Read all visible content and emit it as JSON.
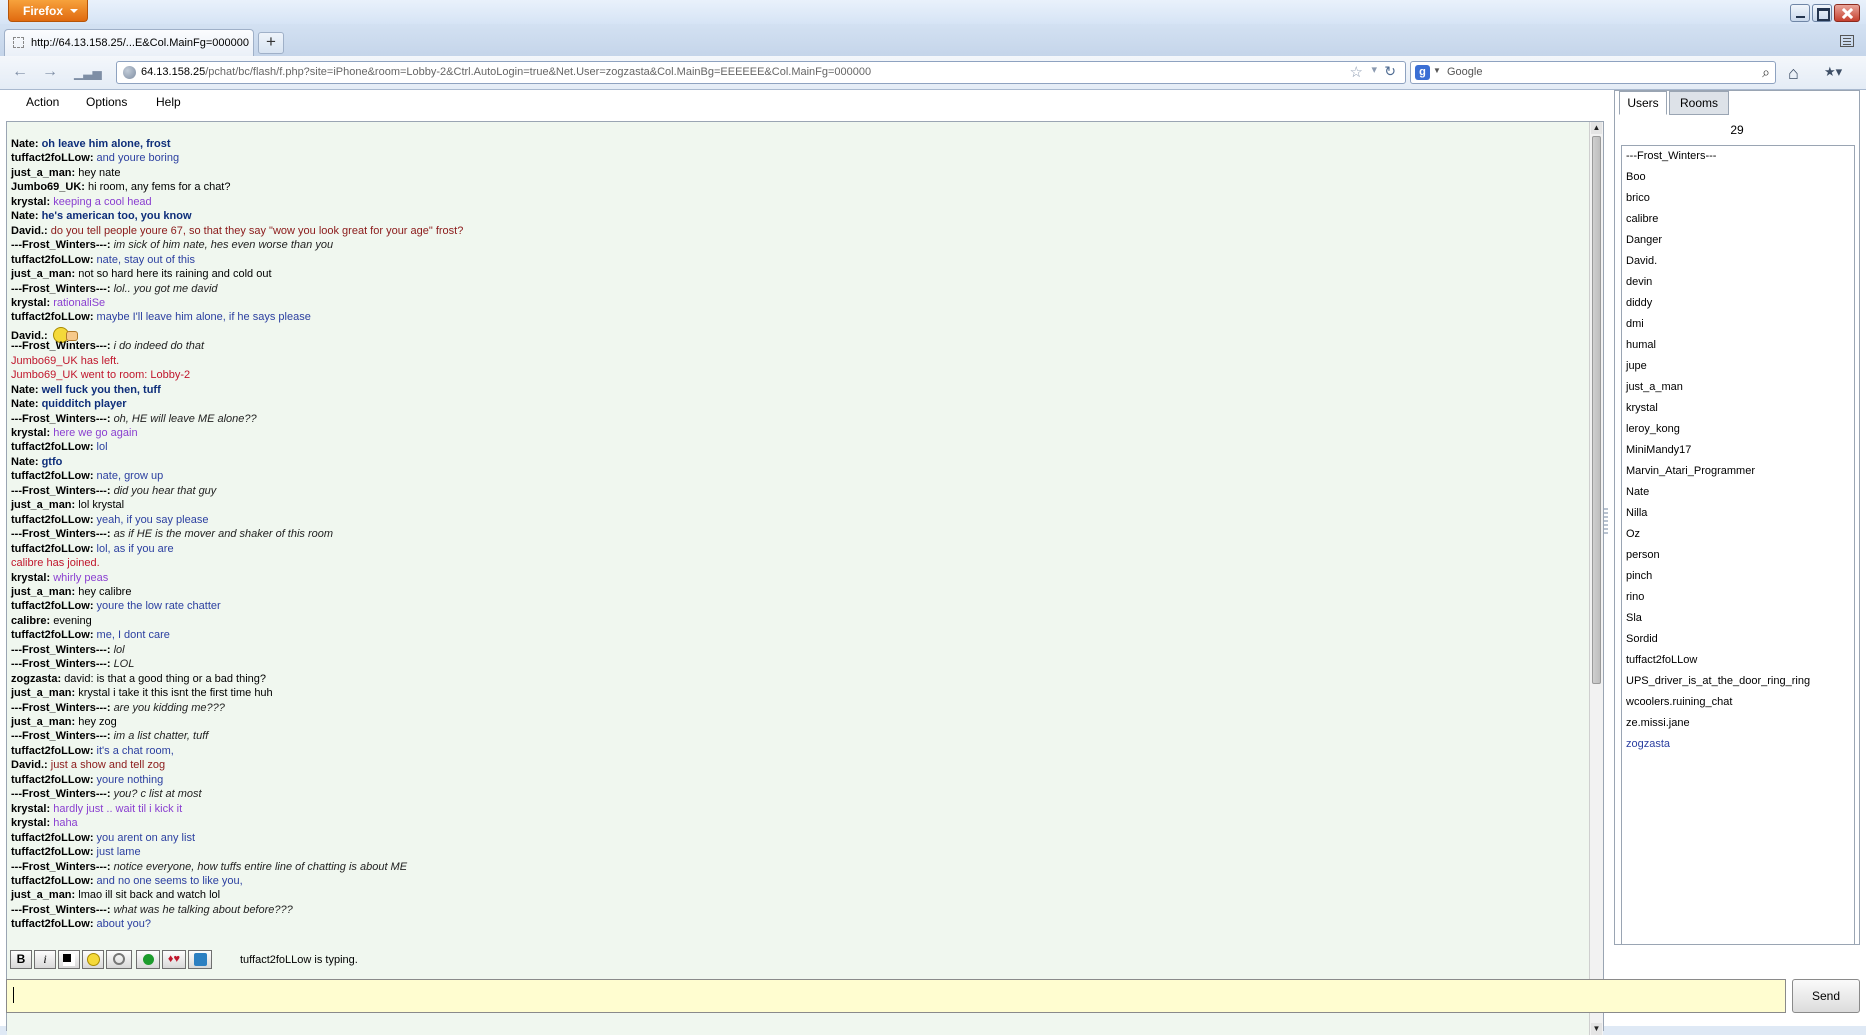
{
  "browser": {
    "app_button": "Firefox",
    "tab_title": "http://64.13.158.25/...E&Col.MainFg=000000",
    "url_host": "64.13.158.25",
    "url_path": "/pchat/bc/flash/f.php?site=iPhone&room=Lobby-2&Ctrl.AutoLogin=true&Net.User=zogzasta&Col.MainBg=EEEEEE&Col.MainFg=000000",
    "search_engine": "Google"
  },
  "menu": [
    "Action",
    "Options",
    "Help"
  ],
  "colors": {
    "frost": "#222222",
    "tuff": "#2b3fa0",
    "krystal": "#8a3fd0",
    "nate": "#0e2e7a",
    "david": "#8b1a1a",
    "system": "#c0162c",
    "plain": "#000000"
  },
  "chat": [
    {
      "nick": "Nate:",
      "text": "oh leave him alone, frost",
      "style": "nate"
    },
    {
      "nick": "tuffact2foLLow:",
      "text": "and youre boring",
      "style": "tuff"
    },
    {
      "nick": "just_a_man:",
      "text": "hey nate",
      "style": "plain"
    },
    {
      "nick": "Jumbo69_UK:",
      "text": "hi room, any fems for a chat?",
      "style": "plain"
    },
    {
      "nick": "krystal:",
      "text": "keeping a cool head",
      "style": "krystal"
    },
    {
      "nick": "Nate:",
      "text": "he's american too, you know",
      "style": "nate"
    },
    {
      "nick": "David.:",
      "text": "do you tell people youre 67, so that they say \"wow you look great for your age\" frost?",
      "style": "david"
    },
    {
      "nick": "---Frost_Winters---:",
      "text": "im sick of him nate, hes even worse than you",
      "style": "frost"
    },
    {
      "nick": "tuffact2foLLow:",
      "text": "nate, stay out of this",
      "style": "tuff"
    },
    {
      "nick": "just_a_man:",
      "text": "not so hard here its raining and cold out",
      "style": "plain"
    },
    {
      "nick": "---Frost_Winters---:",
      "text": "lol.. you got me david",
      "style": "frost"
    },
    {
      "nick": "krystal:",
      "text": "rationaliSe",
      "style": "krystal"
    },
    {
      "nick": "tuffact2foLLow:",
      "text": "maybe I'll leave him alone, if he says please",
      "style": "tuff"
    },
    {
      "nick": "David.:",
      "text": "",
      "style": "david",
      "emoji": true
    },
    {
      "nick": "---Frost_Winters---:",
      "text": "i do indeed do that",
      "style": "frost"
    },
    {
      "nick": "",
      "text": "Jumbo69_UK has left.",
      "style": "system"
    },
    {
      "nick": "",
      "text": "Jumbo69_UK went to room: Lobby-2",
      "style": "system"
    },
    {
      "nick": "Nate:",
      "text": "well fuck you then, tuff",
      "style": "nate"
    },
    {
      "nick": "Nate:",
      "text": "quidditch player",
      "style": "nate"
    },
    {
      "nick": "---Frost_Winters---:",
      "text": "oh, HE will leave ME alone??",
      "style": "frost"
    },
    {
      "nick": "krystal:",
      "text": "here we go again",
      "style": "krystal"
    },
    {
      "nick": "tuffact2foLLow:",
      "text": "lol",
      "style": "tuff"
    },
    {
      "nick": "Nate:",
      "text": "gtfo",
      "style": "nate"
    },
    {
      "nick": "tuffact2foLLow:",
      "text": "nate, grow up",
      "style": "tuff"
    },
    {
      "nick": "---Frost_Winters---:",
      "text": "did  you hear that guy",
      "style": "frost"
    },
    {
      "nick": "just_a_man:",
      "text": "lol krystal",
      "style": "plain"
    },
    {
      "nick": "tuffact2foLLow:",
      "text": "yeah, if you say please",
      "style": "tuff"
    },
    {
      "nick": "---Frost_Winters---:",
      "text": "as if HE is the mover and shaker of this room",
      "style": "frost"
    },
    {
      "nick": "tuffact2foLLow:",
      "text": "lol, as  if you are",
      "style": "tuff"
    },
    {
      "nick": "",
      "text": "calibre has joined.",
      "style": "system"
    },
    {
      "nick": "krystal:",
      "text": "whirly peas",
      "style": "krystal"
    },
    {
      "nick": "just_a_man:",
      "text": "hey calibre",
      "style": "plain"
    },
    {
      "nick": "tuffact2foLLow:",
      "text": "youre the low rate chatter",
      "style": "tuff"
    },
    {
      "nick": "calibre:",
      "text": "evening",
      "style": "plain"
    },
    {
      "nick": "tuffact2foLLow:",
      "text": "me, I dont care",
      "style": "tuff"
    },
    {
      "nick": "---Frost_Winters---:",
      "text": "lol",
      "style": "frost"
    },
    {
      "nick": "---Frost_Winters---:",
      "text": "LOL",
      "style": "frost"
    },
    {
      "nick": "zogzasta:",
      "text": "david: is that a good thing or a bad thing?",
      "style": "plain"
    },
    {
      "nick": "just_a_man:",
      "text": "krystal i take it this isnt the first time huh",
      "style": "plain"
    },
    {
      "nick": "---Frost_Winters---:",
      "text": "are you kidding me???",
      "style": "frost"
    },
    {
      "nick": "just_a_man:",
      "text": "hey zog",
      "style": "plain"
    },
    {
      "nick": "---Frost_Winters---:",
      "text": "im a  list chatter, tuff",
      "style": "frost"
    },
    {
      "nick": "tuffact2foLLow:",
      "text": "it's a chat room,",
      "style": "tuff"
    },
    {
      "nick": "David.:",
      "text": "just a show and tell zog",
      "style": "david"
    },
    {
      "nick": "tuffact2foLLow:",
      "text": "youre nothing",
      "style": "tuff"
    },
    {
      "nick": "---Frost_Winters---:",
      "text": "you?  c  list at most",
      "style": "frost"
    },
    {
      "nick": "krystal:",
      "text": "hardly just .. wait til i kick it",
      "style": "krystal"
    },
    {
      "nick": "krystal:",
      "text": "haha",
      "style": "krystal"
    },
    {
      "nick": "tuffact2foLLow:",
      "text": "you arent  on any list",
      "style": "tuff"
    },
    {
      "nick": "tuffact2foLLow:",
      "text": "just lame",
      "style": "tuff"
    },
    {
      "nick": "---Frost_Winters---:",
      "text": "notice everyone, how tuffs entire line of chatting is about ME",
      "style": "frost"
    },
    {
      "nick": "tuffact2foLLow:",
      "text": "and no one seems to like you,",
      "style": "tuff"
    },
    {
      "nick": "just_a_man:",
      "text": "lmao ill sit back and watch lol",
      "style": "plain"
    },
    {
      "nick": "---Frost_Winters---:",
      "text": "what was he talking about before???",
      "style": "frost"
    },
    {
      "nick": "tuffact2foLLow:",
      "text": "about you?",
      "style": "tuff"
    }
  ],
  "side": {
    "tab_users": "Users",
    "tab_rooms": "Rooms",
    "user_count": "29",
    "users": [
      "---Frost_Winters---",
      "Boo",
      "brico",
      "calibre",
      "Danger",
      "David.",
      "devin",
      "diddy",
      "dmi",
      "humal",
      "jupe",
      "just_a_man",
      "krystal",
      "leroy_kong",
      "MiniMandy17",
      "Marvin_Atari_Programmer",
      "Nate",
      "Nilla",
      "Oz",
      "person",
      "pinch",
      "rino",
      "Sla",
      "Sordid",
      "tuffact2foLLow",
      "UPS_driver_is_at_the_door_ring_ring",
      "wcoolers.ruining_chat",
      "ze.missi.jane",
      "zogzasta"
    ],
    "self_user": "zogzasta"
  },
  "toolbar": {
    "buttons": [
      "bold",
      "italic",
      "color",
      "smiley",
      "sound",
      "status",
      "cards",
      "profile"
    ],
    "typing_status": "tuffact2foLLow is typing."
  },
  "input": {
    "value": "",
    "send_label": "Send"
  }
}
